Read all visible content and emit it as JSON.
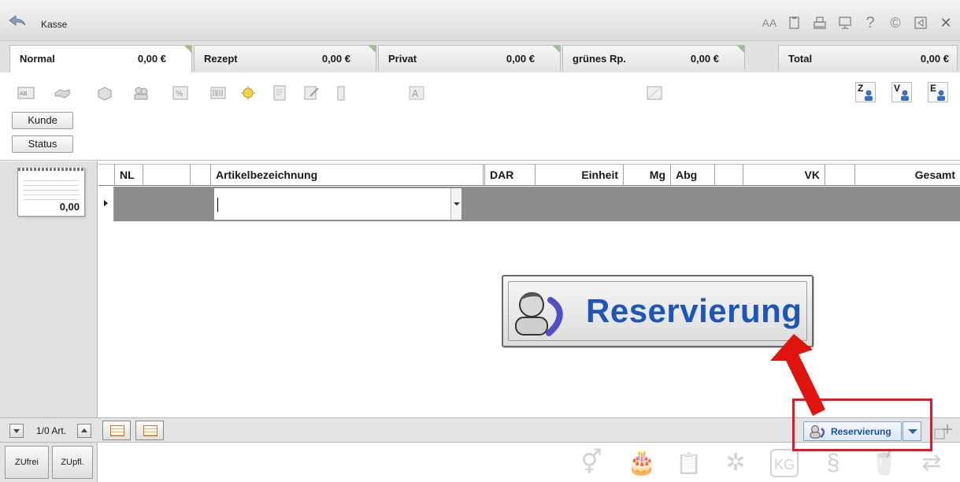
{
  "window": {
    "title": "Kasse"
  },
  "title_icons": [
    "font-size-icon",
    "clipboard-icon",
    "printer-icon",
    "monitor-icon",
    "help-icon",
    "copyright-icon",
    "minimize-icon",
    "close-icon"
  ],
  "title_glyphs": {
    "font": "AA",
    "help": "?",
    "copyright": "©",
    "close": "✕"
  },
  "tabs": [
    {
      "label": "Normal",
      "value": "0,00 €"
    },
    {
      "label": "Rezept",
      "value": "0,00 €"
    },
    {
      "label": "Privat",
      "value": "0,00 €"
    },
    {
      "label": "grünes Rp.",
      "value": "0,00 €"
    },
    {
      "label": "Total",
      "value": "0,00 €"
    }
  ],
  "toolbar": {
    "kunde_label": "Kunde",
    "status_label": "Status",
    "right_buttons": [
      "Z",
      "V",
      "E"
    ]
  },
  "receipt": {
    "amount": "0,00"
  },
  "grid": {
    "headers": {
      "nl": "NL",
      "artikel": "Artikelbezeichnung",
      "dar": "DAR",
      "einheit": "Einheit",
      "mg": "Mg",
      "abg": "Abg",
      "vk": "VK",
      "gesamt": "Gesamt"
    }
  },
  "bottom": {
    "article_count": "1/0 Art.",
    "reservation_label": "Reservierung"
  },
  "footer": {
    "zufrei_label": "ZUfrei",
    "zupfl_label": "ZUpfl.",
    "icons": [
      "gender-icon",
      "birthday-cake-icon",
      "clipboard-check-icon",
      "tree-icon",
      "weight-kg-icon",
      "kidney-icon",
      "drink-icon",
      "transfer-icon"
    ],
    "glyphs": [
      "⚥",
      "🎂",
      "📋",
      "✲",
      "KG",
      "§",
      "🥤",
      "⇄"
    ]
  },
  "zoom": {
    "label": "Reservierung"
  },
  "colors": {
    "accent": "#1d56b8",
    "highlight": "#e0182a",
    "row_fill": "#8c8c8c"
  }
}
